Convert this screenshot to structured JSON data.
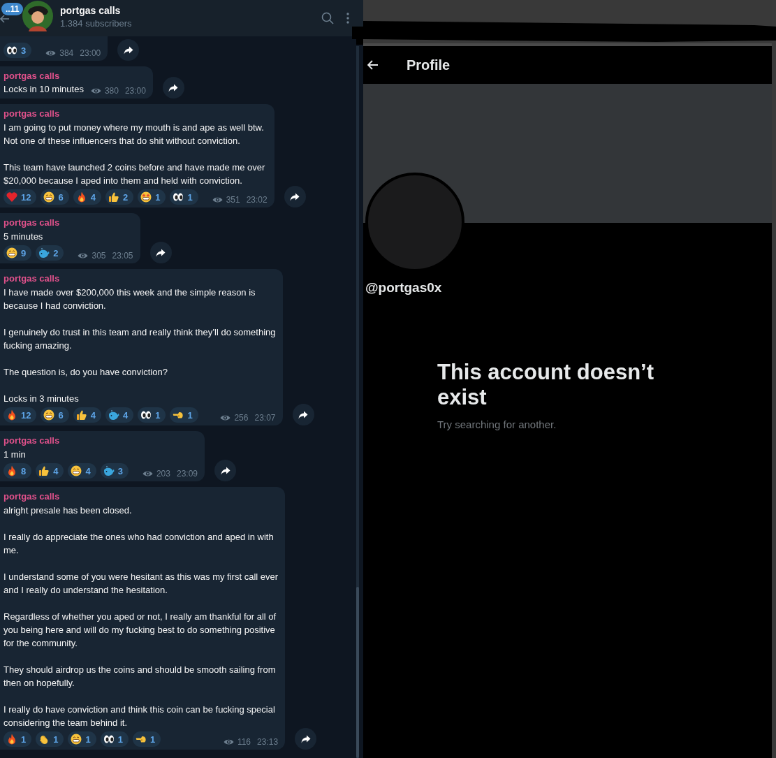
{
  "chat": {
    "badge": "..11",
    "title": "portgas calls",
    "subtitle": "1.384 subscribers",
    "messages": [
      {
        "reactions": [
          {
            "kind": "eyes",
            "count": "3"
          }
        ],
        "views": "384",
        "time": "23:00"
      },
      {
        "author": "portgas calls",
        "text": "Locks in 10 minutes",
        "views": "380",
        "time": "23:00"
      },
      {
        "author": "portgas calls",
        "text": "I am going to put money where my mouth is and ape as well btw.\nNot one of these influencers that do shit without conviction.\n\nThis team have launched 2 coins before and have made me over\n$20,000 because I aped into them and held with conviction.",
        "reactions": [
          {
            "kind": "heart",
            "count": "12"
          },
          {
            "kind": "grin",
            "count": "6"
          },
          {
            "kind": "fire",
            "count": "4"
          },
          {
            "kind": "thumbs",
            "count": "2"
          },
          {
            "kind": "starstruck",
            "count": "1"
          },
          {
            "kind": "eyes",
            "count": "1"
          }
        ],
        "views": "351",
        "time": "23:02"
      },
      {
        "author": "portgas calls",
        "text": "5 minutes",
        "reactions": [
          {
            "kind": "grin",
            "count": "9"
          },
          {
            "kind": "whale",
            "count": "2"
          }
        ],
        "views": "305",
        "time": "23:05"
      },
      {
        "author": "portgas calls",
        "text": "I have made over $200,000 this week and the simple reason is\nbecause I had conviction.\n\nI genuinely do trust in this team and really think they’ll do something\nfucking amazing.\n\nThe question is, do you have conviction?\n\nLocks in 3 minutes",
        "reactions": [
          {
            "kind": "fire",
            "count": "12"
          },
          {
            "kind": "grin",
            "count": "6"
          },
          {
            "kind": "thumbs",
            "count": "4"
          },
          {
            "kind": "whale",
            "count": "4"
          },
          {
            "kind": "eyes",
            "count": "1"
          },
          {
            "kind": "point",
            "count": "1"
          }
        ],
        "views": "256",
        "time": "23:07"
      },
      {
        "author": "portgas calls",
        "text": "1 min",
        "reactions": [
          {
            "kind": "fire",
            "count": "8"
          },
          {
            "kind": "thumbs",
            "count": "4"
          },
          {
            "kind": "grin",
            "count": "4"
          },
          {
            "kind": "whale",
            "count": "3"
          }
        ],
        "views": "203",
        "time": "23:09"
      },
      {
        "author": "portgas calls",
        "text": "alright presale has been closed.\n\nI really do appreciate the ones who had conviction and aped in with\nme.\n\nI understand some of you were hesitant as this was my first call ever\nand I really do understand the hesitation.\n\nRegardless of whether you aped or not, I really am thankful for all of\nyou being here and will do my fucking best to do something positive\nfor the community.\n\nThey should airdrop us the coins and should be smooth sailing from\nthen on hopefully.\n\nI really do have conviction and think this coin can be fucking special\nconsidering the team behind it.",
        "reactions": [
          {
            "kind": "fire",
            "count": "1"
          },
          {
            "kind": "clap",
            "count": "1"
          },
          {
            "kind": "grin",
            "count": "1"
          },
          {
            "kind": "eyes",
            "count": "1"
          },
          {
            "kind": "point",
            "count": "1"
          }
        ],
        "views": "116",
        "time": "23:13"
      }
    ]
  },
  "profile": {
    "title": "Profile",
    "handle": "@portgas0x",
    "heading": "This account doesn’t exist",
    "hint": "Try searching for another."
  }
}
